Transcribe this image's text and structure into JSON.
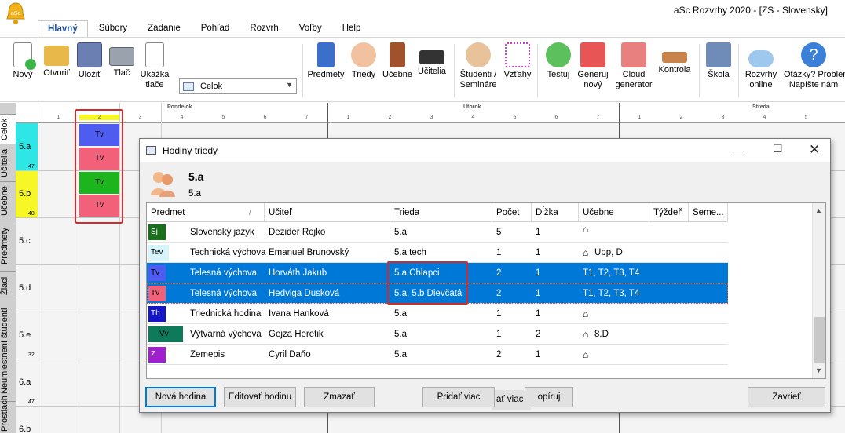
{
  "app": {
    "title": "aSc Rozvrhy 2020  - [ZS - Slovensky]"
  },
  "ribbon_tabs": [
    "Hlavný",
    "Súbory",
    "Zadanie",
    "Pohľad",
    "Rozvrh",
    "Voľby",
    "Help"
  ],
  "toolbar": {
    "new": "Nový",
    "open": "Otvoriť",
    "save": "Uložiť",
    "print": "Tlač",
    "preview_1": "Ukážka",
    "preview_2": "tlače",
    "filter_value": "Celok",
    "subjects": "Predmety",
    "classes": "Triedy",
    "rooms": "Učebne",
    "teachers": "Učitelia",
    "students_1": "Študenti /",
    "students_2": "Semináre",
    "relations": "Vzťahy",
    "test": "Testuj",
    "generate_1": "Generuj",
    "generate_2": "nový",
    "cloud_1": "Cloud",
    "cloud_2": "generator",
    "check": "Kontrola",
    "school": "Škola",
    "online_1": "Rozvrhy",
    "online_2": "online",
    "help_1": "Otázky? Problém?",
    "help_2": "Napíšte nám"
  },
  "colors": {
    "accent": "#0078d7",
    "highlight": "#d42a2a"
  },
  "side_tabs": [
    "Celok",
    "Učitelia",
    "Učebne",
    "Predmety",
    "Žiaci",
    "Neumiestnení študenti",
    "Prostiach"
  ],
  "timetable": {
    "days": [
      "Pondelok",
      "Utorok",
      "Streda"
    ],
    "periods": [
      "1",
      "2",
      "3",
      "4",
      "5",
      "6",
      "7",
      "1",
      "2",
      "3",
      "4",
      "5",
      "6",
      "7",
      "1",
      "2",
      "3",
      "4",
      "5"
    ],
    "rows": [
      {
        "name": "5.a",
        "num": "47"
      },
      {
        "name": "5.b",
        "num": "48"
      },
      {
        "name": "5.c",
        "num": ""
      },
      {
        "name": "5.d",
        "num": ""
      },
      {
        "name": "5.e",
        "num": "32"
      },
      {
        "name": "6.a",
        "num": "47"
      },
      {
        "name": "6.b",
        "num": ""
      }
    ],
    "cells": [
      {
        "label": "Tv",
        "color": "#4f5cf0"
      },
      {
        "label": "Tv",
        "color": "#f2607a"
      },
      {
        "label": "Tv",
        "color": "#1db51d"
      },
      {
        "label": "Tv",
        "color": "#f2607a"
      }
    ]
  },
  "dialog": {
    "title": "Hodiny triedy",
    "class_name": "5.a",
    "class_sub": "5.a",
    "columns": [
      "Predmet",
      "Učiteľ",
      "Trieda",
      "Počet",
      "Dĺžka",
      "Učebne",
      "Týždeň",
      "Seme..."
    ],
    "rows": [
      {
        "chip": "Sj",
        "chip_color": "#1b6e1b",
        "subject": "Slovenský jazyk",
        "teacher": "Dezider Rojko",
        "class": "5.a",
        "count": "5",
        "length": "1",
        "rooms": ""
      },
      {
        "chip": "Tev",
        "chip_color": "#d8f4fb",
        "subject": "Technická výchova",
        "teacher": "Emanuel Brunovský",
        "class": "5.a tech",
        "count": "1",
        "length": "1",
        "rooms": "Upp, D"
      },
      {
        "chip": "Tv",
        "chip_color": "#4f5cf0",
        "subject": "Telesná výchova",
        "teacher": "Horváth Jakub",
        "class": "5.a Chlapci",
        "count": "2",
        "length": "1",
        "rooms": "T1, T2, T3, T4"
      },
      {
        "chip": "Tv",
        "chip_color": "#f2607a",
        "subject": "Telesná výchova",
        "teacher": "Hedviga Dusková",
        "class": "5.a, 5.b Dievčatá",
        "count": "2",
        "length": "1",
        "rooms": "T1, T2, T3, T4"
      },
      {
        "chip": "Th",
        "chip_color": "#1414c8",
        "subject": "Triednická hodina",
        "teacher": "Ivana Hanková",
        "class": "5.a",
        "count": "1",
        "length": "1",
        "rooms": ""
      },
      {
        "chip": "Vv",
        "chip_color": "#0f7a5a",
        "subject": "Výtvarná výchova",
        "teacher": "Gejza Heretik",
        "class": "5.a",
        "count": "1",
        "length": "2",
        "rooms": "8.D"
      },
      {
        "chip": "Z",
        "chip_color": "#a020d0",
        "subject": "Zemepis",
        "teacher": "Cyril Daňo",
        "class": "5.a",
        "count": "2",
        "length": "1",
        "rooms": ""
      }
    ],
    "buttons": {
      "new": "Nová hodina",
      "edit": "Editovať hodinu",
      "delete": "Zmazať",
      "add_more": "Pridať viac",
      "more_partial": "ať viac",
      "copy_partial": "opíruj",
      "close": "Zavrieť"
    }
  }
}
